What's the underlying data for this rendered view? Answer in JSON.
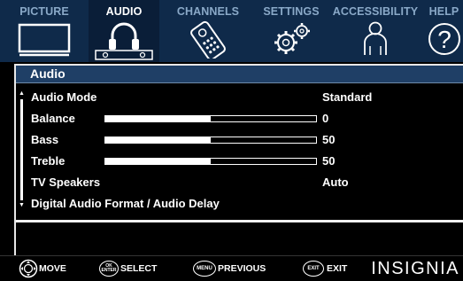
{
  "tabs": [
    {
      "id": "picture",
      "label": "PICTURE",
      "icon": "tv-icon"
    },
    {
      "id": "audio",
      "label": "AUDIO",
      "icon": "headphones-icon",
      "active": true
    },
    {
      "id": "channels",
      "label": "CHANNELS",
      "icon": "remote-icon"
    },
    {
      "id": "settings",
      "label": "SETTINGS",
      "icon": "gears-icon"
    },
    {
      "id": "accessibility",
      "label": "ACCESSIBILITY",
      "icon": "person-icon"
    },
    {
      "id": "help",
      "label": "HELP",
      "icon": "question-icon"
    }
  ],
  "panel": {
    "title": "Audio",
    "rows": [
      {
        "label": "Audio Mode",
        "value": "Standard"
      },
      {
        "label": "Balance",
        "value": "0",
        "slider_level": 0.5
      },
      {
        "label": "Bass",
        "value": "50",
        "slider_level": 0.5
      },
      {
        "label": "Treble",
        "value": "50",
        "slider_level": 0.5
      },
      {
        "label": "TV Speakers",
        "value": "Auto"
      },
      {
        "label": "Digital Audio Format / Audio Delay",
        "value": ""
      }
    ]
  },
  "footer": {
    "hints": [
      {
        "button": "",
        "label": "MOVE",
        "icon": "dpad-icon"
      },
      {
        "button": "OK ENTER",
        "button_line1": "OK",
        "button_line2": "ENTER",
        "label": "SELECT",
        "icon": "ok-enter-button-icon"
      },
      {
        "button": "MENU",
        "label": "PREVIOUS",
        "icon": "menu-button-icon"
      },
      {
        "button": "EXIT",
        "label": "EXIT",
        "icon": "exit-button-icon"
      }
    ],
    "brand": "INSIGNIA"
  },
  "colors": {
    "tab_bar": "#0f2a4a",
    "tab_inactive_text": "#8aa9c8",
    "header_bar": "#1f3f66",
    "background": "#000000",
    "foreground": "#ffffff"
  }
}
